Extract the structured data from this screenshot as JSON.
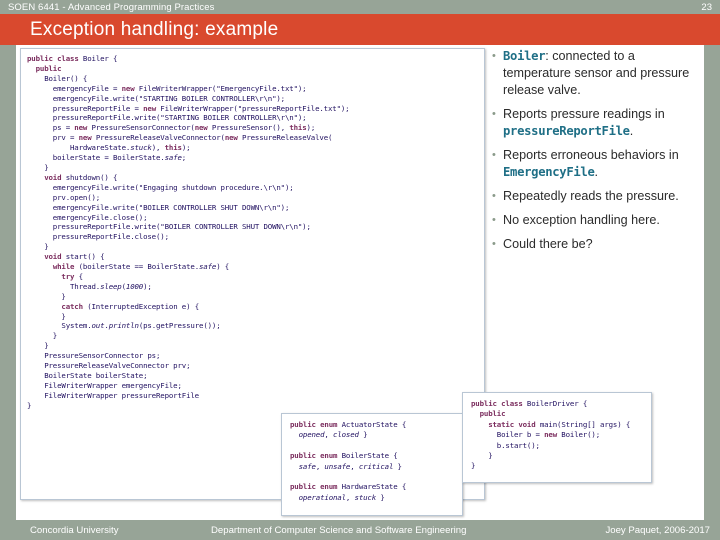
{
  "topbar": {
    "course": "SOEN 6441 - Advanced Programming Practices",
    "page_number": "23"
  },
  "title": {
    "text": "Exception handling: example",
    "banner_color": "#d9492e"
  },
  "theme": {
    "background": "#97a497",
    "panel": "#ffffff",
    "accent": "#d9492e",
    "code_text": "#201060",
    "keyword": "#7b2d5e",
    "mono_accent": "#1f6f86"
  },
  "code_main": {
    "title": "Boiler class source",
    "text": "public class Boiler {\n  public\n    Boiler() {\n      emergencyFile = new FileWriterWrapper(\"EmergencyFile.txt\");\n      emergencyFile.write(\"STARTING BOILER CONTROLLER\\r\\n\");\n      pressureReportFile = new FileWriterWrapper(\"pressureReportFile.txt\");\n      pressureReportFile.write(\"STARTING BOILER CONTROLLER\\r\\n\");\n      ps = new PressureSensorConnector(new PressureSensor(), this);\n      prv = new PressureReleaseValveConnector(new PressureReleaseValve(\n          HardwareState.stuck), this);\n      boilerState = BoilerState.safe;\n    }\n    void shutdown() {\n      emergencyFile.write(\"Engaging shutdown procedure.\\r\\n\");\n      prv.open();\n      emergencyFile.write(\"BOILER CONTROLLER SHUT DOWN\\r\\n\");\n      emergencyFile.close();\n      pressureReportFile.write(\"BOILER CONTROLLER SHUT DOWN\\r\\n\");\n      pressureReportFile.close();\n    }\n    void start() {\n      while (boilerState == BoilerState.safe) {\n        try {\n          Thread.sleep(1000);\n        }\n        catch (InterruptedException e) {\n        }\n        System.out.println(ps.getPressure());\n      }\n    }\n    PressureSensorConnector ps;\n    PressureReleaseValveConnector prv;\n    BoilerState boilerState;\n    FileWriterWrapper emergencyFile;\n    FileWriterWrapper pressureReportFile\n}"
  },
  "code_enums": {
    "title": "State enumerations",
    "text": "public enum ActuatorState {\n  opened, closed }\n\npublic enum BoilerState {\n  safe, unsafe, critical }\n\npublic enum HardwareState {\n  operational, stuck }"
  },
  "code_driver": {
    "title": "BoilerDriver class source",
    "text": "public class BoilerDriver {\n  public\n    static void main(String[] args) {\n      Boiler b = new Boiler();\n      b.start();\n    }\n}"
  },
  "bullets": [
    {
      "parts": [
        {
          "text": "Boiler",
          "mono": true
        },
        {
          "text": ": connected to a temperature sensor and pressure release valve.",
          "mono": false
        }
      ]
    },
    {
      "parts": [
        {
          "text": "Reports pressure readings in ",
          "mono": false
        },
        {
          "text": "pressureReportFile",
          "mono": true
        },
        {
          "text": ".",
          "mono": false
        }
      ]
    },
    {
      "parts": [
        {
          "text": "Reports erroneous behaviors in ",
          "mono": false
        },
        {
          "text": "EmergencyFile",
          "mono": true
        },
        {
          "text": ".",
          "mono": false
        }
      ]
    },
    {
      "parts": [
        {
          "text": "Repeatedly reads the pressure.",
          "mono": false
        }
      ]
    },
    {
      "parts": [
        {
          "text": "No exception handling here.",
          "mono": false
        }
      ]
    },
    {
      "parts": [
        {
          "text": "Could there be?",
          "mono": false
        }
      ]
    }
  ],
  "footer": {
    "left": "Concordia University",
    "center": "Department of Computer Science and Software Engineering",
    "right": "Joey Paquet, 2006-2017"
  }
}
